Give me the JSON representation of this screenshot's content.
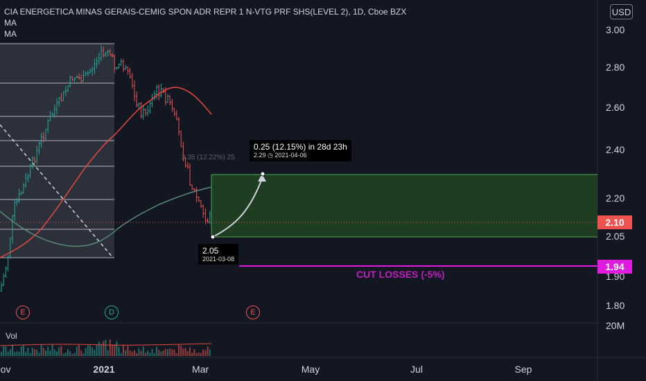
{
  "header": {
    "title": "CIA ENERGETICA MINAS GERAIS-CEMIG SPON ADR REPR 1 N-VTG PRF SHS(LEVEL 2), 1D, Cboe BZX",
    "indicator_1": "MA",
    "indicator_2": "MA",
    "currency_button": "USD"
  },
  "price_axis": {
    "ticks": [
      "3.00",
      "2.80",
      "2.60",
      "2.40",
      "2.20",
      "2.05",
      "1.90",
      "1.80"
    ],
    "volume_tick": "20M",
    "current_price": "2.10",
    "stop_price": "1.94",
    "current_price_color": "#ef5350",
    "stop_price_color": "#e01be0"
  },
  "time_axis": {
    "labels": [
      "Nov",
      "2021",
      "Mar",
      "May",
      "Jul",
      "Sep"
    ]
  },
  "volume_label": "Vol",
  "measurement": {
    "headline": "0.25 (12.15%) in 28d 23h",
    "target_price": "2.29",
    "target_date": "2021-04-06",
    "entry_price": "2.05",
    "entry_date": "2021-03-08",
    "faint_label": "2.35 (12.22%) 25"
  },
  "cut_losses_label": "CUT LOSSES (-5%)",
  "events": [
    {
      "letter": "E",
      "color": "#ef5350"
    },
    {
      "letter": "D",
      "color": "#26a69a"
    },
    {
      "letter": "E",
      "color": "#ef5350"
    }
  ],
  "colors": {
    "background": "#131722",
    "up": "#26a69a",
    "down": "#ef5350",
    "ma_fast": "#e8483c",
    "ma_slow": "#5b8a7e",
    "target_zone": "#1f3d20",
    "target_border": "#4caf50",
    "cut_line": "#e01be0"
  },
  "chart_data": {
    "type": "candlestick",
    "price_range": [
      1.72,
      3.07
    ],
    "price_scale_labels": [
      3.0,
      2.8,
      2.6,
      2.4,
      2.2,
      2.05,
      1.9,
      1.8
    ],
    "annotations": {
      "target_zone": {
        "low": 2.05,
        "high": 2.29,
        "start": "2021-03-08"
      },
      "stop_loss": 1.94,
      "current_price": 2.1
    }
  }
}
